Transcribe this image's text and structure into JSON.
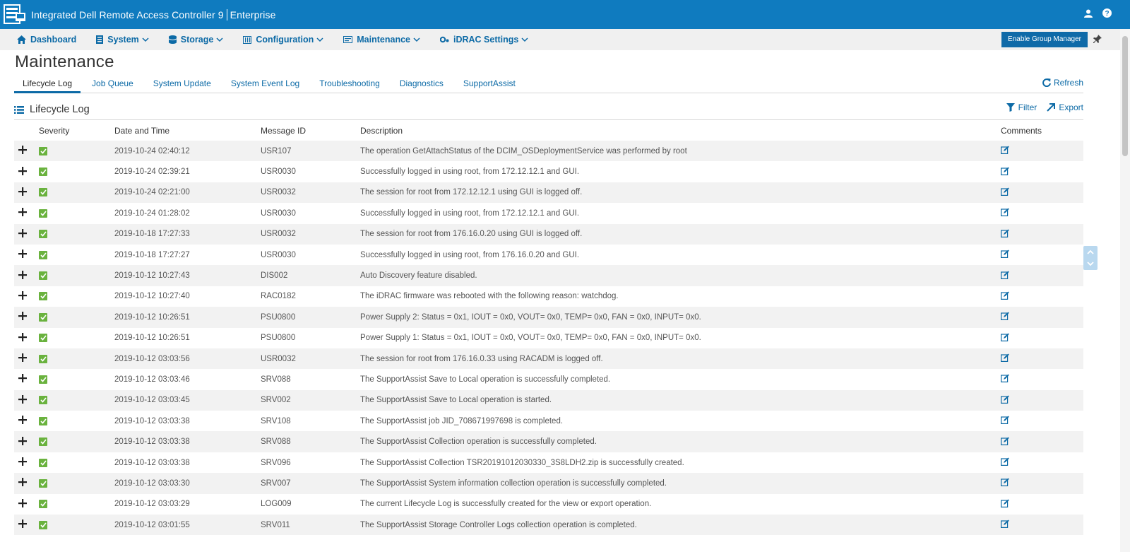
{
  "header": {
    "title": "Integrated Dell Remote Access Controller 9",
    "edition": "Enterprise",
    "icons": [
      "user-icon",
      "help-icon"
    ]
  },
  "nav": {
    "items": [
      {
        "label": "Dashboard",
        "icon": "home-icon",
        "dropdown": false
      },
      {
        "label": "System",
        "icon": "server-icon",
        "dropdown": true
      },
      {
        "label": "Storage",
        "icon": "database-icon",
        "dropdown": true
      },
      {
        "label": "Configuration",
        "icon": "config-icon",
        "dropdown": true
      },
      {
        "label": "Maintenance",
        "icon": "maintenance-icon",
        "dropdown": true
      },
      {
        "label": "iDRAC Settings",
        "icon": "gears-icon",
        "dropdown": true
      }
    ],
    "group_manager_label": "Enable Group Manager"
  },
  "page": {
    "title": "Maintenance",
    "refresh_label": "Refresh",
    "tabs": [
      {
        "label": "Lifecycle Log",
        "active": true
      },
      {
        "label": "Job Queue",
        "active": false
      },
      {
        "label": "System Update",
        "active": false
      },
      {
        "label": "System Event Log",
        "active": false
      },
      {
        "label": "Troubleshooting",
        "active": false
      },
      {
        "label": "Diagnostics",
        "active": false
      },
      {
        "label": "SupportAssist",
        "active": false
      }
    ]
  },
  "section": {
    "title": "Lifecycle Log",
    "filter_label": "Filter",
    "export_label": "Export"
  },
  "table": {
    "columns": [
      "Severity",
      "Date and Time",
      "Message ID",
      "Description",
      "Comments"
    ],
    "rows": [
      {
        "date": "2019-10-24 02:40:12",
        "msg_id": "USR107",
        "desc": "The operation GetAttachStatus of the DCIM_OSDeploymentService was performed by root"
      },
      {
        "date": "2019-10-24 02:39:21",
        "msg_id": "USR0030",
        "desc": "Successfully logged in using root, from 172.12.12.1 and GUI."
      },
      {
        "date": "2019-10-24 02:21:00",
        "msg_id": "USR0032",
        "desc": "The session for root from 172.12.12.1 using GUI is logged off."
      },
      {
        "date": "2019-10-24 01:28:02",
        "msg_id": "USR0030",
        "desc": "Successfully logged in using root, from 172.12.12.1 and GUI."
      },
      {
        "date": "2019-10-18 17:27:33",
        "msg_id": "USR0032",
        "desc": "The session for root from 176.16.0.20 using GUI is logged off."
      },
      {
        "date": "2019-10-18 17:27:27",
        "msg_id": "USR0030",
        "desc": "Successfully logged in using root, from 176.16.0.20 and GUI."
      },
      {
        "date": "2019-10-12 10:27:43",
        "msg_id": "DIS002",
        "desc": "Auto Discovery feature disabled."
      },
      {
        "date": "2019-10-12 10:27:40",
        "msg_id": "RAC0182",
        "desc": "The iDRAC firmware was rebooted with the following reason: watchdog."
      },
      {
        "date": "2019-10-12 10:26:51",
        "msg_id": "PSU0800",
        "desc": "Power Supply 2: Status = 0x1, IOUT = 0x0, VOUT= 0x0, TEMP= 0x0, FAN = 0x0, INPUT= 0x0."
      },
      {
        "date": "2019-10-12 10:26:51",
        "msg_id": "PSU0800",
        "desc": "Power Supply 1: Status = 0x1, IOUT = 0x0, VOUT= 0x0, TEMP= 0x0, FAN = 0x0, INPUT= 0x0."
      },
      {
        "date": "2019-10-12 03:03:56",
        "msg_id": "USR0032",
        "desc": "The session for root from 176.16.0.33 using RACADM is logged off."
      },
      {
        "date": "2019-10-12 03:03:46",
        "msg_id": "SRV088",
        "desc": "The SupportAssist Save to Local operation is successfully completed."
      },
      {
        "date": "2019-10-12 03:03:45",
        "msg_id": "SRV002",
        "desc": "The SupportAssist Save to Local operation is started."
      },
      {
        "date": "2019-10-12 03:03:38",
        "msg_id": "SRV108",
        "desc": "The SupportAssist job JID_708671997698 is completed."
      },
      {
        "date": "2019-10-12 03:03:38",
        "msg_id": "SRV088",
        "desc": "The SupportAssist Collection operation is successfully completed."
      },
      {
        "date": "2019-10-12 03:03:38",
        "msg_id": "SRV096",
        "desc": "The SupportAssist Collection TSR20191012030330_3S8LDH2.zip is successfully created."
      },
      {
        "date": "2019-10-12 03:03:30",
        "msg_id": "SRV007",
        "desc": "The SupportAssist System information collection operation is successfully completed."
      },
      {
        "date": "2019-10-12 03:03:29",
        "msg_id": "LOG009",
        "desc": "The current Lifecycle Log is successfully created for the view or export operation."
      },
      {
        "date": "2019-10-12 03:01:55",
        "msg_id": "SRV011",
        "desc": "The SupportAssist Storage Controller Logs collection operation is completed."
      }
    ]
  },
  "colors": {
    "header_bg": "#0f7bbf",
    "link": "#0c6aa6",
    "severity_ok": "#6ab23e",
    "row_alt": "#f2f2f2"
  }
}
